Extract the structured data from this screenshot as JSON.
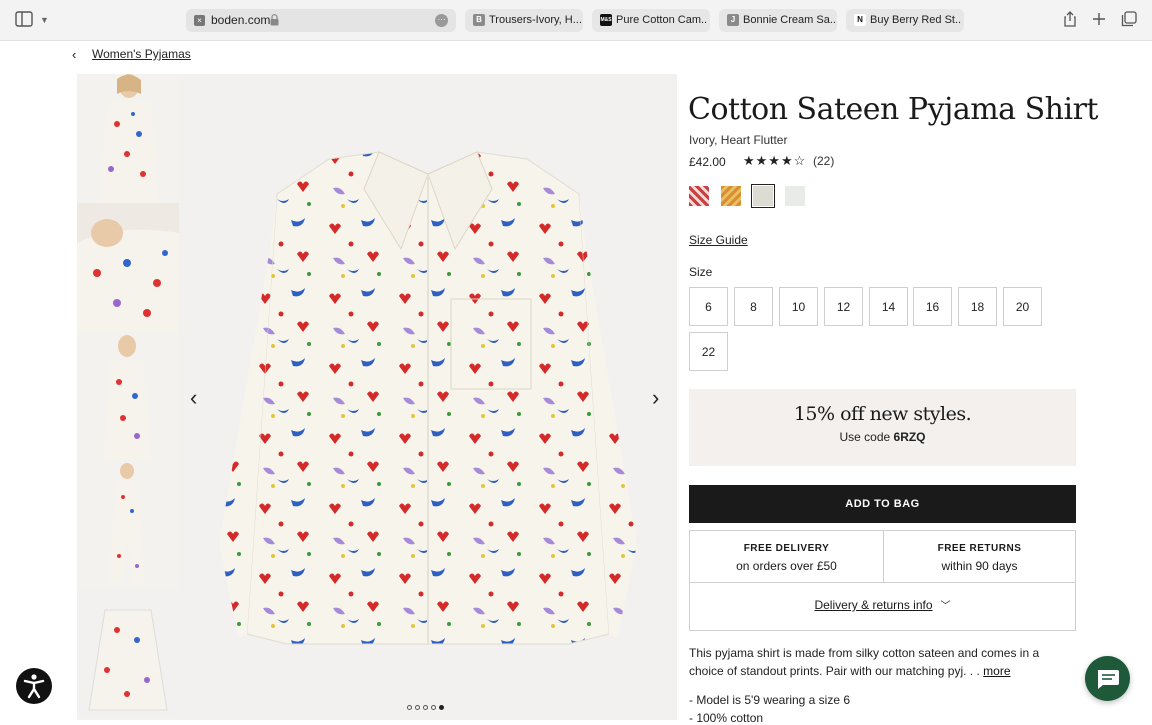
{
  "browser": {
    "url": "boden.com",
    "tabs": [
      {
        "label": "Trousers-Ivory, H...",
        "icon_letter": "B"
      },
      {
        "label": "Pure Cotton Cam...",
        "icon_letter": "M&S"
      },
      {
        "label": "Bonnie Cream Sa...",
        "icon_letter": "J"
      },
      {
        "label": "Buy Berry Red St...",
        "icon_letter": "N"
      }
    ]
  },
  "breadcrumb": {
    "label": "Women's Pyjamas"
  },
  "product": {
    "title": "Cotton Sateen Pyjama Shirt",
    "colour": "Ivory, Heart Flutter",
    "price": "£42.00",
    "rating_stars": 4.5,
    "rating_display": "★★★★☆",
    "review_count": "(22)",
    "swatches": [
      {
        "name": "red-print",
        "color": "#c94040"
      },
      {
        "name": "orange-print",
        "color": "#d98c3a"
      },
      {
        "name": "ivory-print",
        "color": "#dedbd2",
        "selected": true
      },
      {
        "name": "plain-ivory",
        "color": "#e8ece6"
      }
    ]
  },
  "size_guide": "Size Guide",
  "size_label": "Size",
  "sizes": [
    "6",
    "8",
    "10",
    "12",
    "14",
    "16",
    "18",
    "20",
    "22"
  ],
  "promo": {
    "headline": "15% off new styles.",
    "code_prefix": "Use code",
    "code": "6RZQ"
  },
  "add_to_bag": "ADD TO BAG",
  "benefits": [
    {
      "title": "FREE DELIVERY",
      "sub": "on orders over £50"
    },
    {
      "title": "FREE RETURNS",
      "sub": "within 90 days"
    }
  ],
  "delivery_info": "Delivery & returns info",
  "description": {
    "text": "This pyjama shirt is made from silky cotton sateen and comes in a choice of standout prints. Pair with our matching pyj. . .",
    "more": "more"
  },
  "bullets": [
    "- Model is 5'9 wearing a size 6",
    "- 100% cotton"
  ],
  "gallery": {
    "dots": 5,
    "active_dot": 5
  },
  "colors": {
    "brand_dark": "#1a1a1a",
    "promo_bg": "#f3f0ee",
    "chat_bg": "#1e5a3a"
  }
}
